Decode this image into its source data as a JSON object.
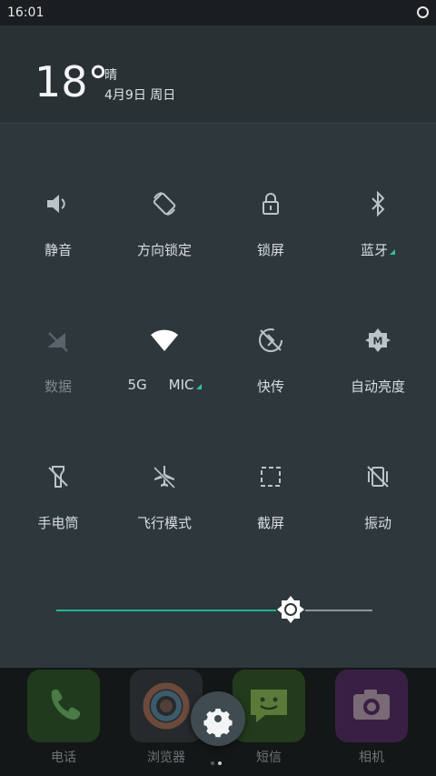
{
  "status": {
    "time": "16:01"
  },
  "weather": {
    "temp": "18°",
    "condition": "晴",
    "date": "4月9日 周日"
  },
  "tiles": [
    {
      "label": "静音",
      "icon": "volume-icon",
      "active": true
    },
    {
      "label": "方向锁定",
      "icon": "rotation-lock-icon",
      "active": true
    },
    {
      "label": "锁屏",
      "icon": "lock-icon",
      "active": true
    },
    {
      "label": "蓝牙",
      "icon": "bluetooth-icon",
      "active": true,
      "expandable": true
    },
    {
      "label": "数据",
      "icon": "mobile-data-off-icon",
      "active": false
    },
    {
      "label_left": "5G",
      "label_right": "MIC",
      "icon": "wifi-icon",
      "active": true,
      "expandable": true
    },
    {
      "label": "快传",
      "icon": "quick-transfer-icon",
      "active": true
    },
    {
      "label": "自动亮度",
      "icon": "auto-brightness-icon",
      "active": true
    },
    {
      "label": "手电筒",
      "icon": "flashlight-icon",
      "active": true
    },
    {
      "label": "飞行模式",
      "icon": "airplane-icon",
      "active": true
    },
    {
      "label": "截屏",
      "icon": "screenshot-icon",
      "active": true
    },
    {
      "label": "振动",
      "icon": "vibrate-off-icon",
      "active": true
    }
  ],
  "brightness": {
    "level": 0.74
  },
  "dock": [
    {
      "label": "电话",
      "icon": "phone-icon",
      "color": "#1f3a1c"
    },
    {
      "label": "浏览器",
      "icon": "browser-icon",
      "color": "#262a2c"
    },
    {
      "label": "短信",
      "icon": "message-icon",
      "color": "#233b1c"
    },
    {
      "label": "相机",
      "icon": "camera-icon",
      "color": "#3a1f44"
    }
  ],
  "colors": {
    "accent": "#20b394",
    "panel": "#2e373c",
    "icon": "#bcc4c8"
  }
}
